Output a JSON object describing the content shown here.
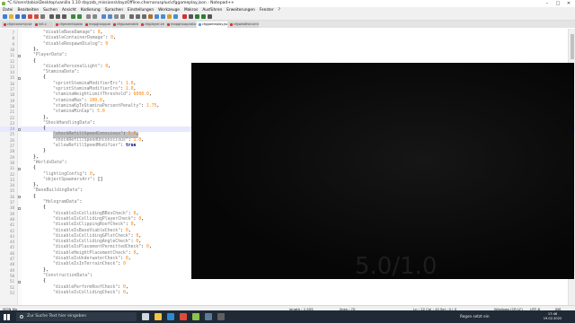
{
  "window": {
    "title": "*C:\\Users\\tobia\\Desktop\\vanilla 1.10 dayzsb_missions\\dayzOffline.chernarusplus\\cfggameplay.json - Notepad++",
    "controls": [
      "–",
      "□",
      "✕"
    ]
  },
  "menu": [
    "Datei",
    "Bearbeiten",
    "Suchen",
    "Ansicht",
    "Kodierung",
    "Sprachen",
    "Einstellungen",
    "Werkzeuge",
    "Makros",
    "Ausführen",
    "Erweiterungen",
    "Fenster",
    "?"
  ],
  "toolbar": {
    "buttons": [
      "new",
      "open",
      "save",
      "save-all",
      "close",
      "close-all",
      "print",
      "cut",
      "copy",
      "paste",
      "undo",
      "redo",
      "find",
      "replace",
      "zoom-in",
      "zoom-out",
      "sync-v",
      "sync-h",
      "wrap",
      "all-chars",
      "indent-guide",
      "lang",
      "doc-map",
      "func-list",
      "folder",
      "monitor",
      "record",
      "stop",
      "play",
      "play-multi",
      "save-macro"
    ],
    "colors": [
      "#3c7fd6",
      "#e0b13a",
      "#3a72c4",
      "#3a72c4",
      "#d14c3c",
      "#d14c3c",
      "#777777",
      "#5a5a5a",
      "#5a5a5a",
      "#5a5a5a",
      "#3c8a3c",
      "#3c8a3c",
      "#888888",
      "#888888",
      "#5a86c4",
      "#5a86c4",
      "#8a8a8a",
      "#8a8a8a",
      "#6a6a6a",
      "#6a6a6a",
      "#6a6a6a",
      "#b07030",
      "#4a8ad4",
      "#4a8ad4",
      "#d4a030",
      "#4a8ad4",
      "#d32f2f",
      "#555555",
      "#2e7d32",
      "#2e7d32",
      "#555555"
    ]
  },
  "tabs": [
    {
      "label": "cfgeconomycore.xml",
      "active": false
    },
    {
      "label": "init.c",
      "active": false
    },
    {
      "label": "cfgeventspawns.xml",
      "active": false
    },
    {
      "label": "mapgrouppos.xml",
      "active": false
    },
    {
      "label": "cfgspawnable.xml",
      "active": false
    },
    {
      "label": "cfgplayer.xml",
      "active": false
    },
    {
      "label": "mapgroupproto.xml",
      "active": false
    },
    {
      "label": "cfggameplay.json",
      "active": true
    },
    {
      "label": "cfgweather.xml",
      "active": false
    }
  ],
  "code_lines": [
    {
      "n": "7",
      "fold": false,
      "indent": 4,
      "text": "\"disableBaseDamage\": 0,"
    },
    {
      "n": "8",
      "fold": false,
      "indent": 4,
      "text": "\"disableContainerDamage\": 0,"
    },
    {
      "n": "9",
      "fold": false,
      "indent": 4,
      "text": "\"disableRespawnDialog\": 0"
    },
    {
      "n": "10",
      "fold": false,
      "indent": 2,
      "text": "},"
    },
    {
      "n": "11",
      "fold": true,
      "indent": 2,
      "text": "\"PlayerData\":"
    },
    {
      "n": "12",
      "fold": false,
      "indent": 2,
      "text": "{"
    },
    {
      "n": "13",
      "fold": false,
      "indent": 4,
      "text": "\"disablePersonalLight\": 0,"
    },
    {
      "n": "14",
      "fold": false,
      "indent": 4,
      "text": "\"StaminaData\":"
    },
    {
      "n": "15",
      "fold": true,
      "indent": 4,
      "text": "{"
    },
    {
      "n": "16",
      "fold": false,
      "indent": 6,
      "text": "\"sprintStaminaModifierErc\": 1.0,"
    },
    {
      "n": "17",
      "fold": false,
      "indent": 6,
      "text": "\"sprintStaminaModifierCro\": 1.0,"
    },
    {
      "n": "18",
      "fold": false,
      "indent": 6,
      "text": "\"staminaWeightLimitThreshold\": 6000.0,"
    },
    {
      "n": "19",
      "fold": false,
      "indent": 6,
      "text": "\"staminaMax\": 100.0,"
    },
    {
      "n": "20",
      "fold": false,
      "indent": 6,
      "text": "\"staminaKgToStaminaPercentPenalty\": 1.75,"
    },
    {
      "n": "21",
      "fold": false,
      "indent": 6,
      "text": "\"staminaMinCap\": 5.0"
    },
    {
      "n": "22",
      "fold": false,
      "indent": 4,
      "text": "},"
    },
    {
      "n": "23",
      "fold": false,
      "indent": 4,
      "text": "\"ShockHandlingData\":"
    },
    {
      "n": "24",
      "fold": true,
      "indent": 4,
      "text": "{"
    },
    {
      "n": "25",
      "fold": false,
      "indent": 6,
      "text": "\"shockRefillSpeedConscious\": 5.0,"
    },
    {
      "n": "26",
      "fold": false,
      "indent": 6,
      "text": "\"shockRefillSpeedUnconscious\": 1.0,"
    },
    {
      "n": "27",
      "fold": false,
      "indent": 6,
      "text": "\"allowRefillSpeedModifier\": true"
    },
    {
      "n": "28",
      "fold": false,
      "indent": 4,
      "text": "}"
    },
    {
      "n": "29",
      "fold": false,
      "indent": 2,
      "text": "},"
    },
    {
      "n": "30",
      "fold": false,
      "indent": 2,
      "text": "\"WorldsData\":"
    },
    {
      "n": "31",
      "fold": true,
      "indent": 2,
      "text": "{"
    },
    {
      "n": "32",
      "fold": false,
      "indent": 4,
      "text": "\"lightingConfig\": 0,"
    },
    {
      "n": "33",
      "fold": false,
      "indent": 4,
      "text": "\"objectSpawnersArr\": []"
    },
    {
      "n": "34",
      "fold": false,
      "indent": 2,
      "text": "},"
    },
    {
      "n": "35",
      "fold": false,
      "indent": 2,
      "text": "\"BaseBuildingData\":"
    },
    {
      "n": "36",
      "fold": true,
      "indent": 2,
      "text": "{"
    },
    {
      "n": "37",
      "fold": false,
      "indent": 4,
      "text": "\"HologramData\":"
    },
    {
      "n": "38",
      "fold": true,
      "indent": 4,
      "text": "{"
    },
    {
      "n": "39",
      "fold": false,
      "indent": 6,
      "text": "\"disableIsCollidingBBoxCheck\": 0,"
    },
    {
      "n": "40",
      "fold": false,
      "indent": 6,
      "text": "\"disableIsCollidingPlayerCheck\": 0,"
    },
    {
      "n": "41",
      "fold": false,
      "indent": 6,
      "text": "\"disableIsClippingRoofCheck\": 0,"
    },
    {
      "n": "42",
      "fold": false,
      "indent": 6,
      "text": "\"disableIsBaseViableCheck\": 0,"
    },
    {
      "n": "43",
      "fold": false,
      "indent": 6,
      "text": "\"disableIsCollidingGPlotCheck\": 0,"
    },
    {
      "n": "44",
      "fold": false,
      "indent": 6,
      "text": "\"disableIsCollidingAngleCheck\": 0,"
    },
    {
      "n": "45",
      "fold": false,
      "indent": 6,
      "text": "\"disableIsPlacementPermittedCheck\": 0,"
    },
    {
      "n": "46",
      "fold": false,
      "indent": 6,
      "text": "\"disableHeightPlacementCheck\": 0,"
    },
    {
      "n": "47",
      "fold": false,
      "indent": 6,
      "text": "\"disableIsUnderwaterCheck\": 0,"
    },
    {
      "n": "48",
      "fold": false,
      "indent": 6,
      "text": "\"disableIsInTerrainCheck\": 0"
    },
    {
      "n": "49",
      "fold": false,
      "indent": 4,
      "text": "},"
    },
    {
      "n": "50",
      "fold": false,
      "indent": 4,
      "text": "\"ConstructionData\":"
    },
    {
      "n": "51",
      "fold": true,
      "indent": 4,
      "text": "{"
    },
    {
      "n": "52",
      "fold": false,
      "indent": 6,
      "text": "\"disablePerformRoofCheck\": 0,"
    },
    {
      "n": "53",
      "fold": false,
      "indent": 6,
      "text": "\"disableIsCollidingCheck\": 0,"
    }
  ],
  "highlight_line": "24",
  "selected_line": "25",
  "video_overlay": {
    "ratio_text": "5.0/1.0"
  },
  "status": {
    "filetype": "JSON file",
    "length": "length : 1,555",
    "lines": "lines : 70",
    "position": "Ln : 22    Col : 10    Sel : 0 | 0",
    "eol": "Windows (CR LF)",
    "encoding": "UTF-8",
    "mode": "INS"
  },
  "taskbar": {
    "search_placeholder": "Zur Suche Text hier eingeben",
    "apps": [
      "task-view",
      "explorer",
      "edge",
      "chrome",
      "notepad",
      "steam",
      "obs"
    ],
    "app_colors": [
      "#cfd8dc",
      "#f4c542",
      "#2a8ad4",
      "#e04a3a",
      "#8bc34a",
      "#5d7a99",
      "#5f5f5f"
    ],
    "weather": "Regen setzt ein",
    "time": "17:46",
    "date": "19.02.2022"
  },
  "colors": {
    "accent": "#4c9be8",
    "taskbar": "#1f2a36",
    "code_key": "#808080",
    "code_number": "#ff8000"
  }
}
